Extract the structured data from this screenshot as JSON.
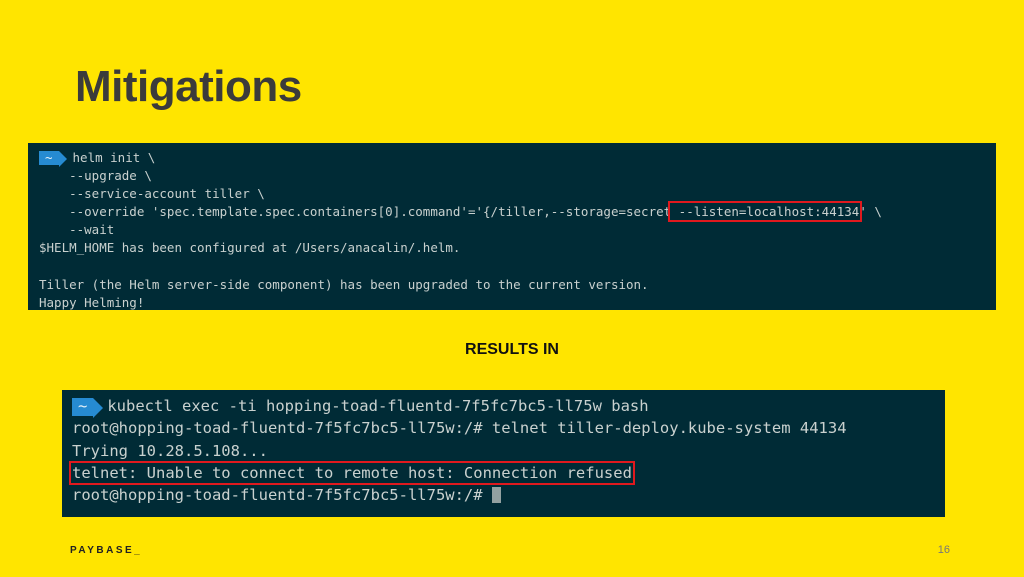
{
  "slide": {
    "title": "Mitigations",
    "results_label": "RESULTS IN",
    "brand": "PAYBASE_",
    "page_number": "16"
  },
  "terminal_top": {
    "prompt_badge": "~",
    "lines": [
      "helm init \\",
      "    --upgrade \\",
      "    --service-account tiller \\",
      "    --override 'spec.template.spec.containers[0].command'='{/tiller,--storage=secret",
      "    --wait",
      "$HELM_HOME has been configured at /Users/anacalin/.helm.",
      "",
      "Tiller (the Helm server-side component) has been upgraded to the current version.",
      "Happy Helming!"
    ],
    "override_highlight": " --listen=localhost:44134",
    "override_tail": "' \\"
  },
  "terminal_bottom": {
    "prompt_badge": "~",
    "lines": [
      "kubectl exec -ti hopping-toad-fluentd-7f5fc7bc5-ll75w bash",
      "root@hopping-toad-fluentd-7f5fc7bc5-ll75w:/# telnet tiller-deploy.kube-system 44134",
      "Trying 10.28.5.108...",
      "telnet: Unable to connect to remote host: Connection refused",
      "root@hopping-toad-fluentd-7f5fc7bc5-ll75w:/# "
    ]
  }
}
